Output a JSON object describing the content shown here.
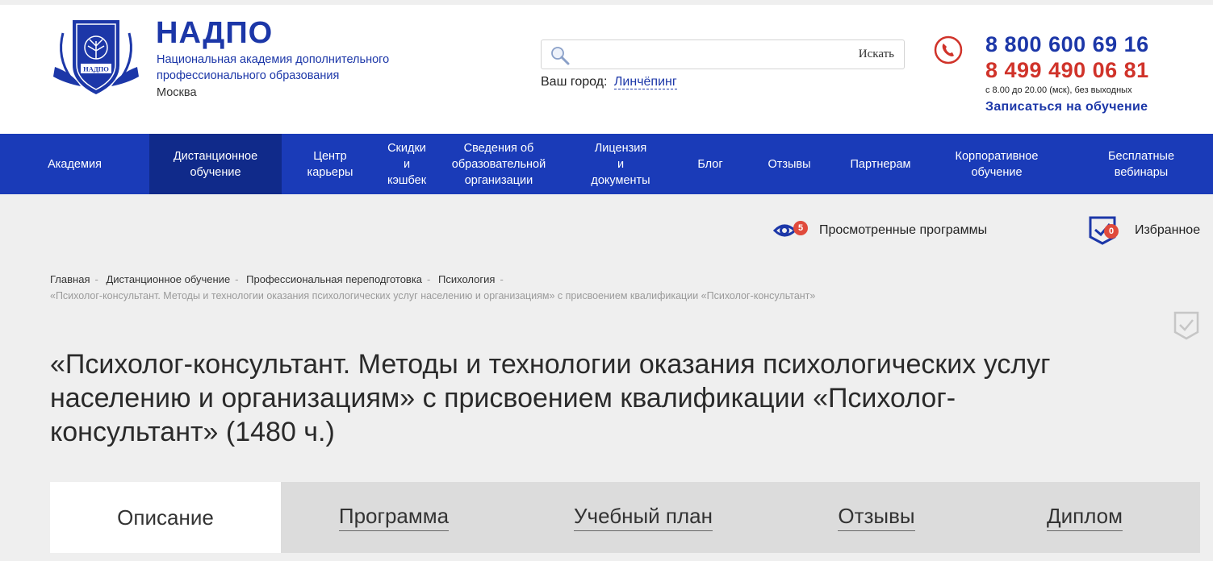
{
  "brand": {
    "name": "НАДПО",
    "subtitle": "Национальная академия дополнительного профессионального образования",
    "city": "Москва",
    "emblem_text": "НАДПО"
  },
  "search": {
    "placeholder": "",
    "button_label": "Искать"
  },
  "location": {
    "label": "Ваш город:",
    "city": "Линчёпинг"
  },
  "contacts": {
    "phone1": "8 800 600 69 16",
    "phone2": "8 499 490 06 81",
    "hours": "с 8.00 до 20.00 (мск), без выходных",
    "enroll_label": "Записаться на обучение"
  },
  "nav": {
    "items": [
      {
        "label": "Академия"
      },
      {
        "label": "Дистанционное\nобучение",
        "active": true
      },
      {
        "label": "Центр\nкарьеры"
      },
      {
        "label": "Скидки\nи\nкэшбек"
      },
      {
        "label": "Сведения об\nобразовательной\nорганизации"
      },
      {
        "label": "Лицензия\nи\nдокументы"
      },
      {
        "label": "Блог"
      },
      {
        "label": "Отзывы"
      },
      {
        "label": "Партнерам"
      },
      {
        "label": "Корпоративное\nобучение"
      },
      {
        "label": "Бесплатные\nвебинары"
      }
    ]
  },
  "utility": {
    "viewed_label": "Просмотренные программы",
    "viewed_count": "5",
    "favorites_label": "Избранное",
    "favorites_count": "0"
  },
  "breadcrumbs": {
    "items": [
      "Главная",
      "Дистанционное обучение",
      "Профессиональная переподготовка",
      "Психология"
    ],
    "current": "«Психолог-консультант. Методы и технологии оказания психологических услуг населению и организациям» с присвоением квалификации «Психолог-консультант»"
  },
  "page": {
    "title": "«Психолог-консультант. Методы и технологии оказания психологических услуг населению и организациям» с присвоением квалификации «Психолог-консультант» (1480 ч.)"
  },
  "tabs": {
    "items": [
      {
        "label": "Описание",
        "active": true
      },
      {
        "label": "Программа"
      },
      {
        "label": "Учебный план"
      },
      {
        "label": "Отзывы"
      },
      {
        "label": "Диплом"
      }
    ]
  },
  "colors": {
    "brand_blue": "#1c37a8",
    "nav_blue": "#1a3bb8",
    "nav_active": "#102a8a",
    "accent_red": "#d0332a"
  }
}
